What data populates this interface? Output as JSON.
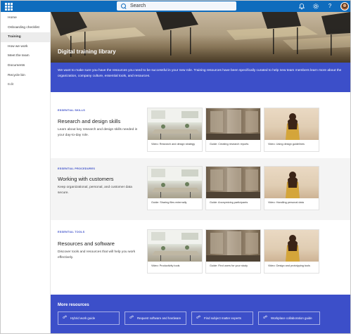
{
  "suitebar": {
    "search_label": "Search",
    "icons": [
      "app-launcher-icon",
      "search-icon",
      "bell-icon",
      "gear-icon",
      "help-icon",
      "user-avatar"
    ]
  },
  "nav": {
    "items": [
      "Home",
      "Onboarding checklist",
      "Training",
      "How we work",
      "Meet the team",
      "Documents",
      "Recycle bin",
      "Edit"
    ],
    "active": "Training"
  },
  "hero": {
    "title": "Digital training library",
    "intro": "We want to make sure you have the resources you need to be successful in your new role. Training resources have been specifically curated to help new team members learn more about the organization, company culture, essential tools, and resources."
  },
  "sections": [
    {
      "eyebrow": "ESSENTIAL SKILLS",
      "heading": "Research and design skills",
      "description": "Learn about key research and design skills needed in your day-to-day role.",
      "cards": [
        {
          "caption": "Video: Research and design strategy"
        },
        {
          "caption": "Guide: Creating research reports"
        },
        {
          "caption": "Video: Using design guidelines"
        }
      ]
    },
    {
      "eyebrow": "ESSENTIAL PROCEDURES",
      "heading": "Working with customers",
      "description": "Keep organizational, personal, and customer data secure.",
      "cards": [
        {
          "caption": "Guide: Sharing files externally"
        },
        {
          "caption": "Guide: Anonymizing participants"
        },
        {
          "caption": "Video: Handling personal data"
        }
      ]
    },
    {
      "eyebrow": "ESSENTIAL TOOLS",
      "heading": "Resources and software",
      "description": "Discover tools and resources that will help you work effectively.",
      "cards": [
        {
          "caption": "Video: Productivity tools"
        },
        {
          "caption": "Guide: Find users for your study"
        },
        {
          "caption": "Video: Design and prototyping tools"
        }
      ]
    }
  ],
  "more_resources": {
    "title": "More resources",
    "links": [
      {
        "label": "Hybrid work guide",
        "icon": "link-icon"
      },
      {
        "label": "Request software and hardware",
        "icon": "link-icon"
      },
      {
        "label": "Find subject matter experts",
        "icon": "link-icon"
      },
      {
        "label": "Workplace collaboration guide",
        "icon": "link-icon"
      }
    ]
  },
  "colors": {
    "suitebar": "#0f6cbd",
    "accent": "#3c4fc9",
    "section_alt_bg": "#f4f4f4"
  }
}
